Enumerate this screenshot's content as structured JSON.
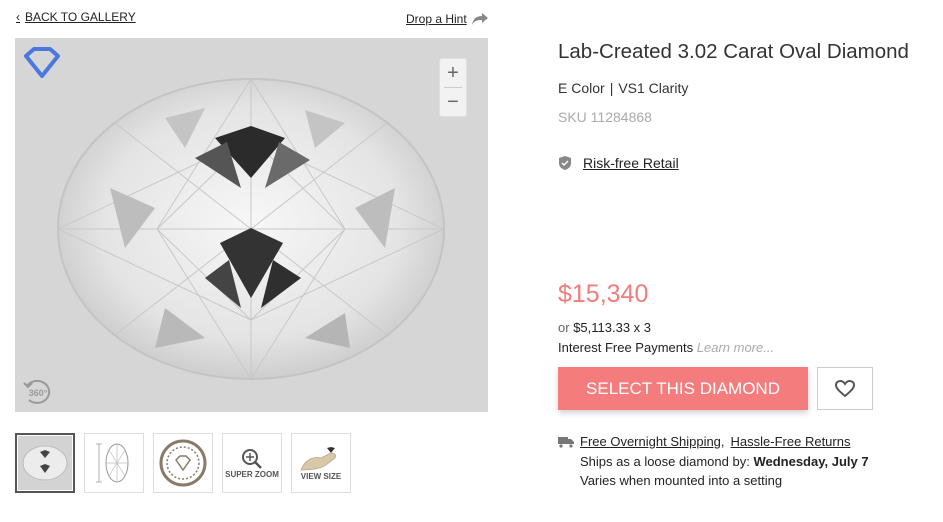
{
  "nav": {
    "back_label": "BACK TO GALLERY",
    "hint_label": "Drop a Hint"
  },
  "viewer": {
    "zoom_in": "+",
    "zoom_out": "−",
    "rotate_label": "360°"
  },
  "thumbnails": [
    {
      "name": "photo",
      "label": ""
    },
    {
      "name": "diagram",
      "label": ""
    },
    {
      "name": "certificate",
      "label": ""
    },
    {
      "name": "super-zoom",
      "label": "SUPER ZOOM"
    },
    {
      "name": "view-size",
      "label": "VIEW SIZE"
    }
  ],
  "product": {
    "title": "Lab-Created 3.02 Carat Oval Diamond",
    "color": "E Color",
    "separator": "|",
    "clarity": "VS1 Clarity",
    "sku": "SKU 11284868",
    "risk_free": "Risk-free Retail"
  },
  "pricing": {
    "price": "$15,340",
    "or": "or",
    "installment": "$5,113.33 x 3",
    "interest_text": "Interest Free Payments",
    "learn_more": "Learn more..."
  },
  "actions": {
    "select_label": "SELECT THIS DIAMOND"
  },
  "shipping": {
    "free_shipping": "Free Overnight Shipping",
    "comma": ",",
    "returns": "Hassle-Free Returns",
    "ships_prefix": "Ships as a loose diamond by:",
    "ships_date": "Wednesday, July 7",
    "mounted_note": "Varies when mounted into a setting"
  },
  "colors": {
    "accent": "#f47c7c",
    "price": "#f07c7c",
    "logo": "#4a78e0"
  },
  "icons": [
    "chevron-left-icon",
    "share-arrow-icon",
    "diamond-logo-icon",
    "zoom-in-icon",
    "zoom-out-icon",
    "rotate-360-icon",
    "shield-check-icon",
    "heart-icon",
    "truck-icon",
    "magnifier-icon",
    "hand-diamond-icon"
  ]
}
